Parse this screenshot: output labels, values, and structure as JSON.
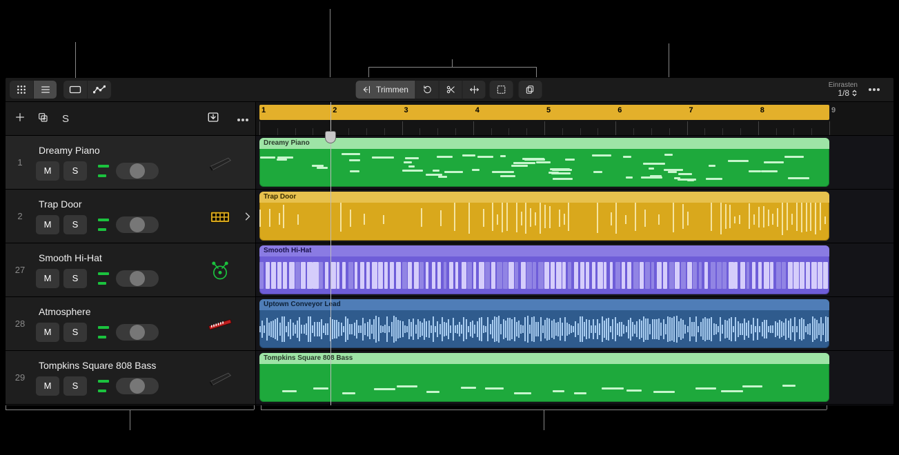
{
  "toolbar": {
    "trim_label": "Trimmen",
    "snap_label": "Einrasten",
    "snap_value": "1/8"
  },
  "ruler": {
    "bar_labels": [
      "1",
      "2",
      "3",
      "4",
      "5",
      "6",
      "7",
      "8"
    ],
    "last_label": "9",
    "playhead_bar": 2,
    "cycle_bars": 8
  },
  "tracks": [
    {
      "idx": "1",
      "name": "Dreamy Piano",
      "meter_color": "#1bc23e",
      "icon": "keyboard-dark",
      "selected": true,
      "disclosure": false,
      "region_color": "green",
      "region_name": "Dreamy Piano",
      "kind": "midi"
    },
    {
      "idx": "2",
      "name": "Trap Door",
      "meter_color": "#1bc23e",
      "icon": "drum-machine",
      "selected": false,
      "disclosure": true,
      "region_color": "yellow",
      "region_name": "Trap Door",
      "kind": "audio-transient"
    },
    {
      "idx": "27",
      "name": "Smooth Hi-Hat",
      "meter_color": "#1bc23e",
      "icon": "drummer",
      "selected": false,
      "disclosure": false,
      "region_color": "purple",
      "region_name": "Smooth Hi-Hat",
      "kind": "slices"
    },
    {
      "idx": "28",
      "name": "Atmosphere",
      "meter_color": "#1bc23e",
      "icon": "synth-red",
      "selected": false,
      "disclosure": false,
      "region_color": "blue",
      "region_name": "Uptown Conveyor Lead",
      "kind": "audio-noise"
    },
    {
      "idx": "29",
      "name": "Tompkins Square 808 Bass",
      "meter_color": "#1bc23e",
      "icon": "keyboard-dark",
      "selected": false,
      "disclosure": false,
      "region_color": "green",
      "region_name": "Tompkins Square 808 Bass",
      "kind": "midi-sparse"
    }
  ]
}
